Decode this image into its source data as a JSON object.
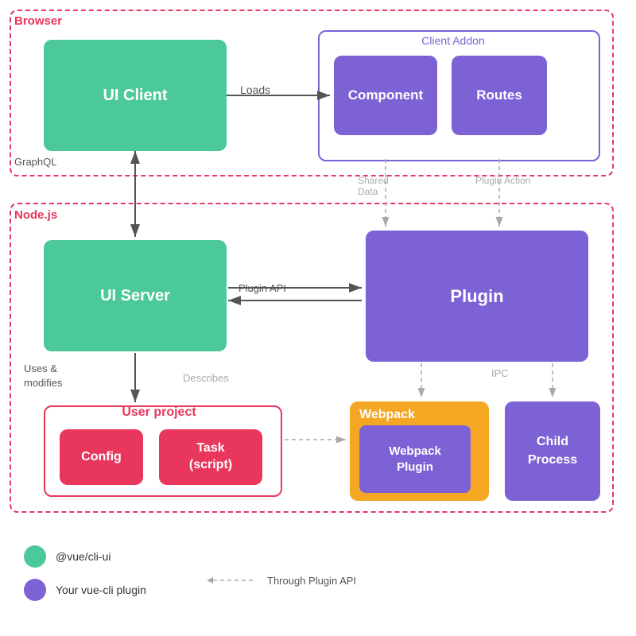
{
  "diagram": {
    "browser_label": "Browser",
    "nodejs_label": "Node.js",
    "ui_client": "UI Client",
    "client_addon": "Client Addon",
    "component": "Component",
    "routes": "Routes",
    "ui_server": "UI Server",
    "plugin": "Plugin",
    "user_project": "User project",
    "config": "Config",
    "task_script": "Task\n(script)",
    "webpack": "Webpack",
    "webpack_plugin": "Webpack\nPlugin",
    "child_process": "Child\nProcess",
    "loads_label": "Loads",
    "graphql_label": "GraphQL",
    "shared_data_label": "Shared\nData",
    "plugin_action_label": "Plugin Action",
    "plugin_api_label": "Plugin API",
    "uses_modifies_label": "Uses &\nmodifies",
    "describes_label": "Describes",
    "ipc_label": "IPC"
  },
  "legend": {
    "green_label": "@vue/cli-ui",
    "purple_label": "Your vue-cli plugin",
    "arrow_label": "Through Plugin API"
  },
  "colors": {
    "green": "#4bc99a",
    "purple": "#7c62d4",
    "red": "#e8365d",
    "yellow": "#f5a623",
    "gray_arrow": "#aaaaaa",
    "dark_arrow": "#555555"
  }
}
